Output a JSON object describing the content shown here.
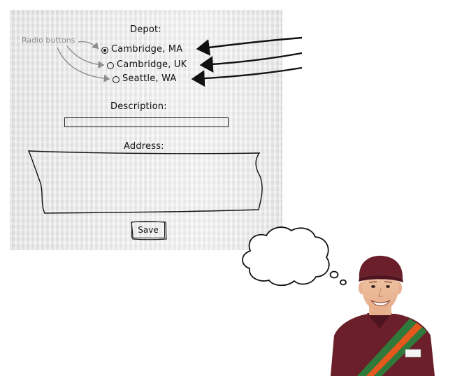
{
  "form": {
    "depot_label": "Depot:",
    "depot_options": [
      {
        "label": "Cambridge, MA",
        "selected": true
      },
      {
        "label": "Cambridge, UK",
        "selected": false
      },
      {
        "label": "Seattle, WA",
        "selected": false
      }
    ],
    "description_label": "Description:",
    "description_value": "",
    "address_label": "Address:",
    "address_value": "",
    "save_label": "Save"
  },
  "annotation": {
    "radio_buttons_label": "Radio buttons"
  },
  "colors": {
    "napkin": "#ededed",
    "ink": "#111111",
    "annotation_ink": "#8c8c8c",
    "uniform_maroon": "#6b1f2a",
    "stripe_green": "#2f7a3b",
    "stripe_orange": "#e35a1c"
  }
}
